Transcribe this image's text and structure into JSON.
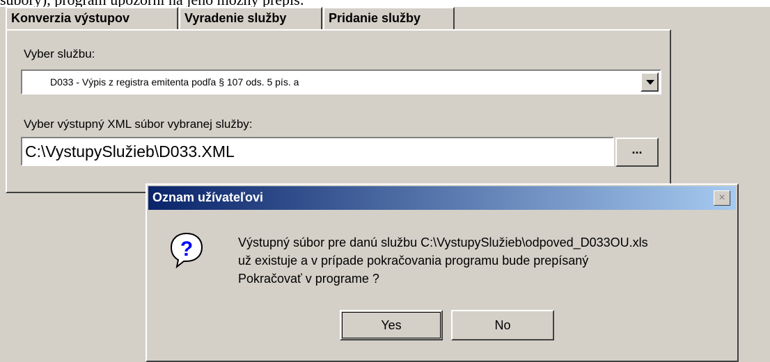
{
  "document": {
    "fragment": "súbory), program upozorní na jeho možný prepis:"
  },
  "tabs": [
    {
      "label": "Konverzia výstupov"
    },
    {
      "label": "Vyradenie služby"
    },
    {
      "label": "Pridanie služby"
    }
  ],
  "panel": {
    "service_label": "Vyber službu:",
    "service_selected": "D033 - Výpis z registra emitenta podľa § 107 ods. 5 pís. a",
    "xml_label": "Vyber výstupný XML súbor vybranej služby:",
    "xml_path": "C:\\VystupySlužieb\\D033.XML",
    "browse_label": "..."
  },
  "dialog": {
    "title": "Oznam užívateľovi",
    "close_glyph": "×",
    "icon": "question-icon",
    "message_lines": [
      "Výstupný súbor pre danú službu C:\\VystupySlužieb\\odpoved_D033OU.xls",
      "už existuje a v prípade pokračovania programu bude prepísaný",
      "Pokračovať v programe ?"
    ],
    "yes_label": "Yes",
    "no_label": "No"
  },
  "colors": {
    "face": "#d4d0c8",
    "titlebar_start": "#0a246a",
    "titlebar_end": "#a6caf0"
  }
}
